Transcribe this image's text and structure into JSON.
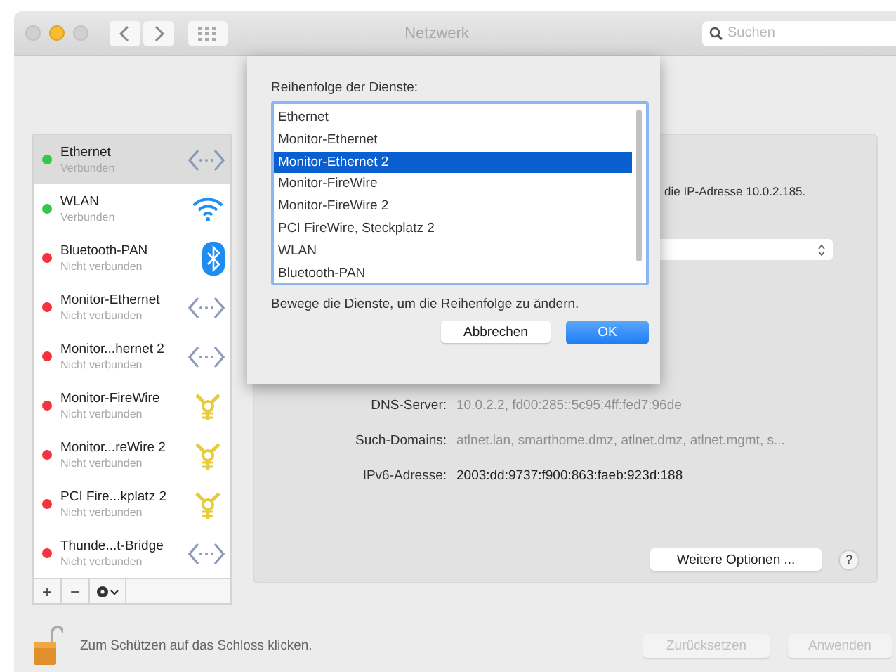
{
  "window": {
    "title": "Netzwerk"
  },
  "search": {
    "placeholder": "Suchen"
  },
  "services": [
    {
      "name": "Ethernet",
      "status": "Verbunden",
      "color": "#34c748",
      "kind": "ethernet",
      "selected": true
    },
    {
      "name": "WLAN",
      "status": "Verbunden",
      "color": "#34c748",
      "kind": "wifi",
      "selected": false
    },
    {
      "name": "Bluetooth-PAN",
      "status": "Nicht verbunden",
      "color": "#f5333f",
      "kind": "bluetooth",
      "selected": false
    },
    {
      "name": "Monitor-Ethernet",
      "status": "Nicht verbunden",
      "color": "#f5333f",
      "kind": "ethernet",
      "selected": false
    },
    {
      "name": "Monitor...hernet 2",
      "status": "Nicht verbunden",
      "color": "#f5333f",
      "kind": "ethernet",
      "selected": false
    },
    {
      "name": "Monitor-FireWire",
      "status": "Nicht verbunden",
      "color": "#f5333f",
      "kind": "firewire",
      "selected": false
    },
    {
      "name": "Monitor...reWire 2",
      "status": "Nicht verbunden",
      "color": "#f5333f",
      "kind": "firewire",
      "selected": false
    },
    {
      "name": "PCI Fire...kplatz 2",
      "status": "Nicht verbunden",
      "color": "#f5333f",
      "kind": "firewire",
      "selected": false
    },
    {
      "name": "Thunde...t-Bridge",
      "status": "Nicht verbunden",
      "color": "#f5333f",
      "kind": "ethernet",
      "selected": false
    }
  ],
  "sidebar_buttons": [
    "+",
    "−"
  ],
  "panel": {
    "status_text": "die IP-Adresse 10.0.2.185.",
    "fields": [
      {
        "label": "DNS-Server:",
        "value": "10.0.2.2, fd00:285::5c95:4ff:fed7:96de",
        "dimmed": true
      },
      {
        "label": "Such-Domains:",
        "value": "atlnet.lan, smarthome.dmz, atlnet.dmz, atlnet.mgmt, s...",
        "dimmed": true
      },
      {
        "label": "IPv6-Adresse:",
        "value": "2003:dd:9737:f900:863:faeb:923d:188",
        "dimmed": false
      }
    ],
    "more_button": "Weitere Optionen ...",
    "help_button": "?"
  },
  "sheet": {
    "title": "Reihenfolge der Dienste:",
    "items": [
      {
        "label": "Ethernet",
        "selected": false
      },
      {
        "label": "Monitor-Ethernet",
        "selected": false
      },
      {
        "label": "Monitor-Ethernet 2",
        "selected": true
      },
      {
        "label": "Monitor-FireWire",
        "selected": false
      },
      {
        "label": "Monitor-FireWire 2",
        "selected": false
      },
      {
        "label": "PCI FireWire, Steckplatz 2",
        "selected": false
      },
      {
        "label": "WLAN",
        "selected": false
      },
      {
        "label": "Bluetooth-PAN",
        "selected": false
      }
    ],
    "hint": "Bewege die Dienste, um die Reihenfolge zu ändern.",
    "cancel": "Abbrechen",
    "ok": "OK"
  },
  "footer": {
    "lock_text": "Zum Schützen auf das Schloss klicken.",
    "buttons": [
      {
        "label": "Zurücksetzen",
        "disabled": true
      },
      {
        "label": "Anwenden",
        "disabled": true
      }
    ]
  }
}
